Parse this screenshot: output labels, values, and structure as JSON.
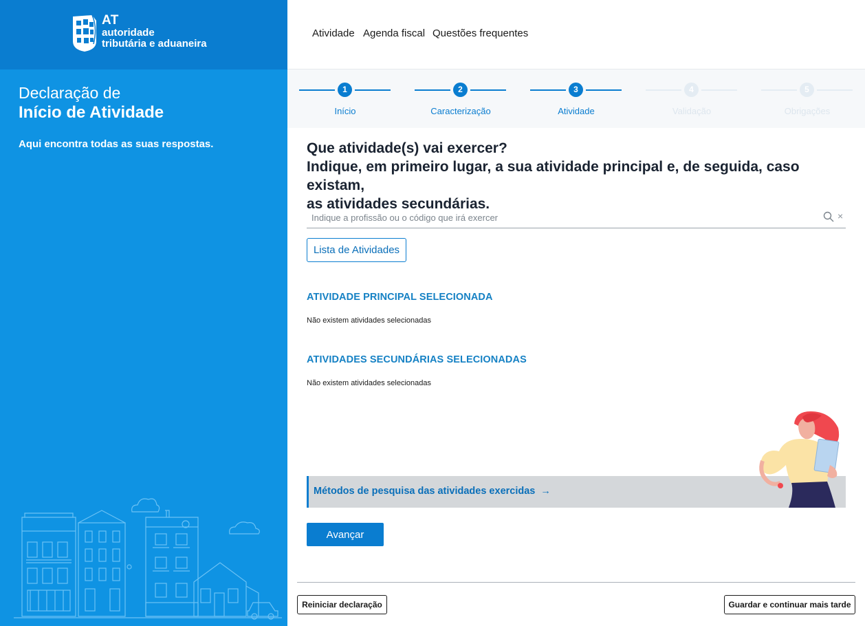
{
  "brand": {
    "logo_at": "AT",
    "logo_line1": "autoridade",
    "logo_line2": "tributária e aduaneira"
  },
  "sidebar": {
    "title_line1": "Declaração de",
    "title_line2": "Início de Atividade",
    "subtitle": "Aqui encontra todas as suas respostas."
  },
  "nav": {
    "items": [
      "Atividade",
      "Agenda fiscal",
      "Questões frequentes"
    ]
  },
  "stepper": {
    "steps": [
      {
        "number": "1",
        "label": "Início",
        "state": "active"
      },
      {
        "number": "2",
        "label": "Caracterização",
        "state": "active"
      },
      {
        "number": "3",
        "label": "Atividade",
        "state": "current"
      },
      {
        "number": "4",
        "label": "Validação",
        "state": "disabled"
      },
      {
        "number": "5",
        "label": "Obrigações",
        "state": "disabled"
      }
    ]
  },
  "main": {
    "question_line1": "Que atividade(s) vai exercer?",
    "question_line2": "Indique, em primeiro lugar, a sua atividade principal e, de seguida, caso existam,",
    "question_line3": "as atividades secundárias.",
    "search_placeholder": "Indique a profissão ou o código que irá exercer",
    "search_value": "",
    "clear_symbol": "×",
    "activity_list_button": "Lista de Atividades",
    "principal_heading": "ATIVIDADE PRINCIPAL SELECIONADA",
    "principal_empty": "Não existem atividades selecionadas",
    "secondary_heading": "ATIVIDADES SECUNDÁRIAS SELECIONADAS",
    "secondary_empty": "Não existem atividades selecionadas",
    "methods_link": "Métodos de pesquisa das atividades exercidas",
    "methods_arrow": "→",
    "next_button": "Avançar"
  },
  "footer": {
    "restart_button": "Reiniciar declaração",
    "save_button": "Guardar e continuar mais tarde"
  },
  "colors": {
    "brand_blue": "#0a7dd0",
    "sidebar_blue": "#0f93e3",
    "heading_blue": "#1581c4"
  }
}
